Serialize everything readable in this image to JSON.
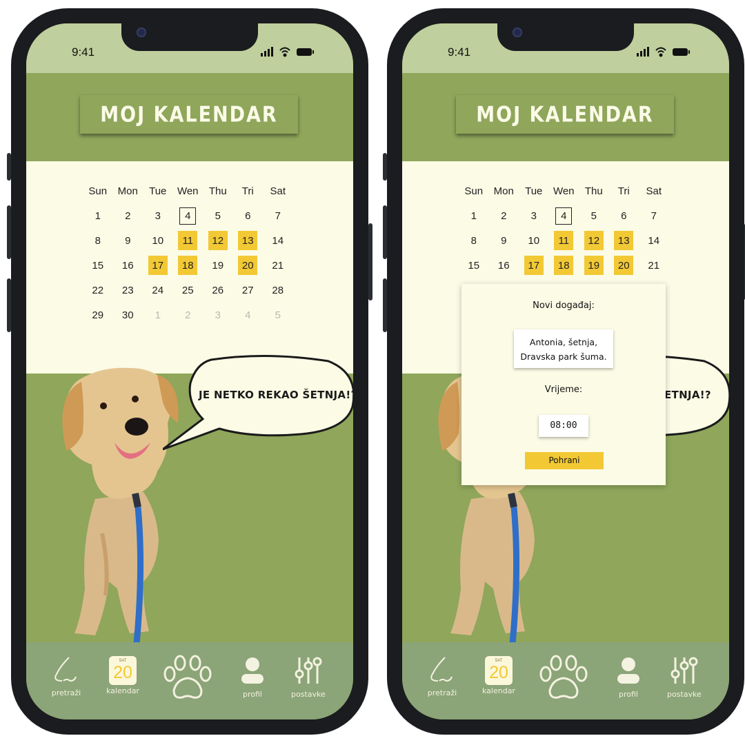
{
  "status_bar": {
    "time": "9:41"
  },
  "header": {
    "title": "MOJ KALENDAR"
  },
  "calendar": {
    "weekdays": [
      "Sun",
      "Mon",
      "Tue",
      "Wen",
      "Thu",
      "Tri",
      "Sat"
    ],
    "today": 4,
    "weeks": [
      [
        "1",
        "2",
        "3",
        "4",
        "5",
        "6",
        "7"
      ],
      [
        "8",
        "9",
        "10",
        "11",
        "12",
        "13",
        "14"
      ],
      [
        "15",
        "16",
        "17",
        "18",
        "19",
        "20",
        "21"
      ],
      [
        "22",
        "23",
        "24",
        "25",
        "26",
        "27",
        "28"
      ],
      [
        "29",
        "30",
        "1",
        "2",
        "3",
        "4",
        "5"
      ]
    ]
  },
  "screen_left": {
    "highlighted_days": [
      "11",
      "12",
      "13",
      "17",
      "18",
      "20"
    ],
    "bubble_text": "JE NETKO REKAO ŠETNJA!?"
  },
  "screen_right": {
    "highlighted_days": [
      "11",
      "12",
      "13",
      "17",
      "18",
      "19",
      "20"
    ],
    "bubble_text_visible": "ETNJA!?"
  },
  "modal": {
    "title": "Novi događaj:",
    "event_line1": "Antonia, šetnja,",
    "event_line2": "Dravska park šuma.",
    "time_label": "Vrijeme:",
    "time_value": "08:00",
    "save_label": "Pohrani"
  },
  "tabbar": {
    "search": {
      "label": "pretraži",
      "icon": "nose-icon"
    },
    "calendar": {
      "label": "kalendar",
      "icon": "calendar-icon",
      "day": "SAT",
      "date": "20"
    },
    "home": {
      "icon": "paw-icon"
    },
    "profile": {
      "label": "profil",
      "icon": "person-icon"
    },
    "settings": {
      "label": "postavke",
      "icon": "sliders-icon"
    }
  },
  "colors": {
    "green": "#8fa65b",
    "cream": "#fbfbe6",
    "yellow": "#f2c935",
    "tabbar": "#8ba478",
    "statusbar": "#bfcf9d"
  }
}
